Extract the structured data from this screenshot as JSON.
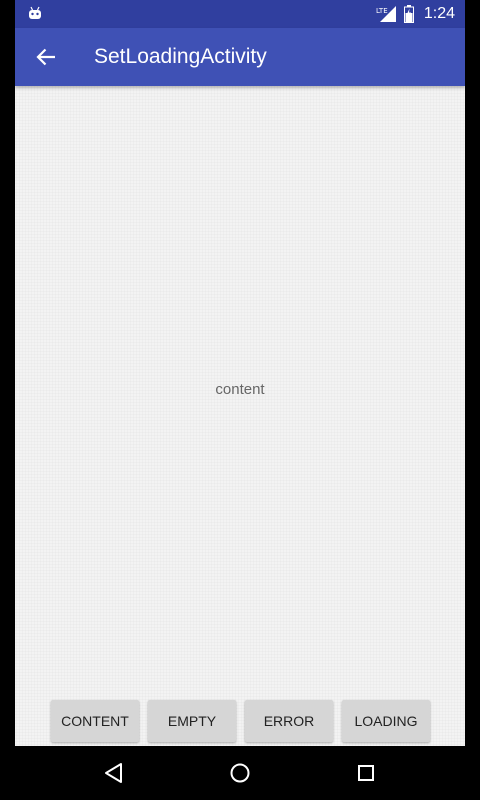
{
  "status_bar": {
    "time": "1:24",
    "network_label": "LTE",
    "icons": [
      "android-icon",
      "lte-signal-icon",
      "battery-icon"
    ]
  },
  "app_bar": {
    "title": "SetLoadingActivity",
    "back_icon": "arrow-back-icon"
  },
  "main": {
    "content_text": "content"
  },
  "buttons": {
    "content_label": "CONTENT",
    "empty_label": "EMPTY",
    "error_label": "ERROR",
    "loading_label": "LOADING"
  },
  "nav_bar": {
    "icons": [
      "back-triangle-icon",
      "home-circle-icon",
      "recents-square-icon"
    ]
  },
  "colors": {
    "status_bar": "#303F9F",
    "app_bar": "#3F51B5",
    "content_bg": "#f3f3f3",
    "button_bg": "#d6d6d6"
  }
}
